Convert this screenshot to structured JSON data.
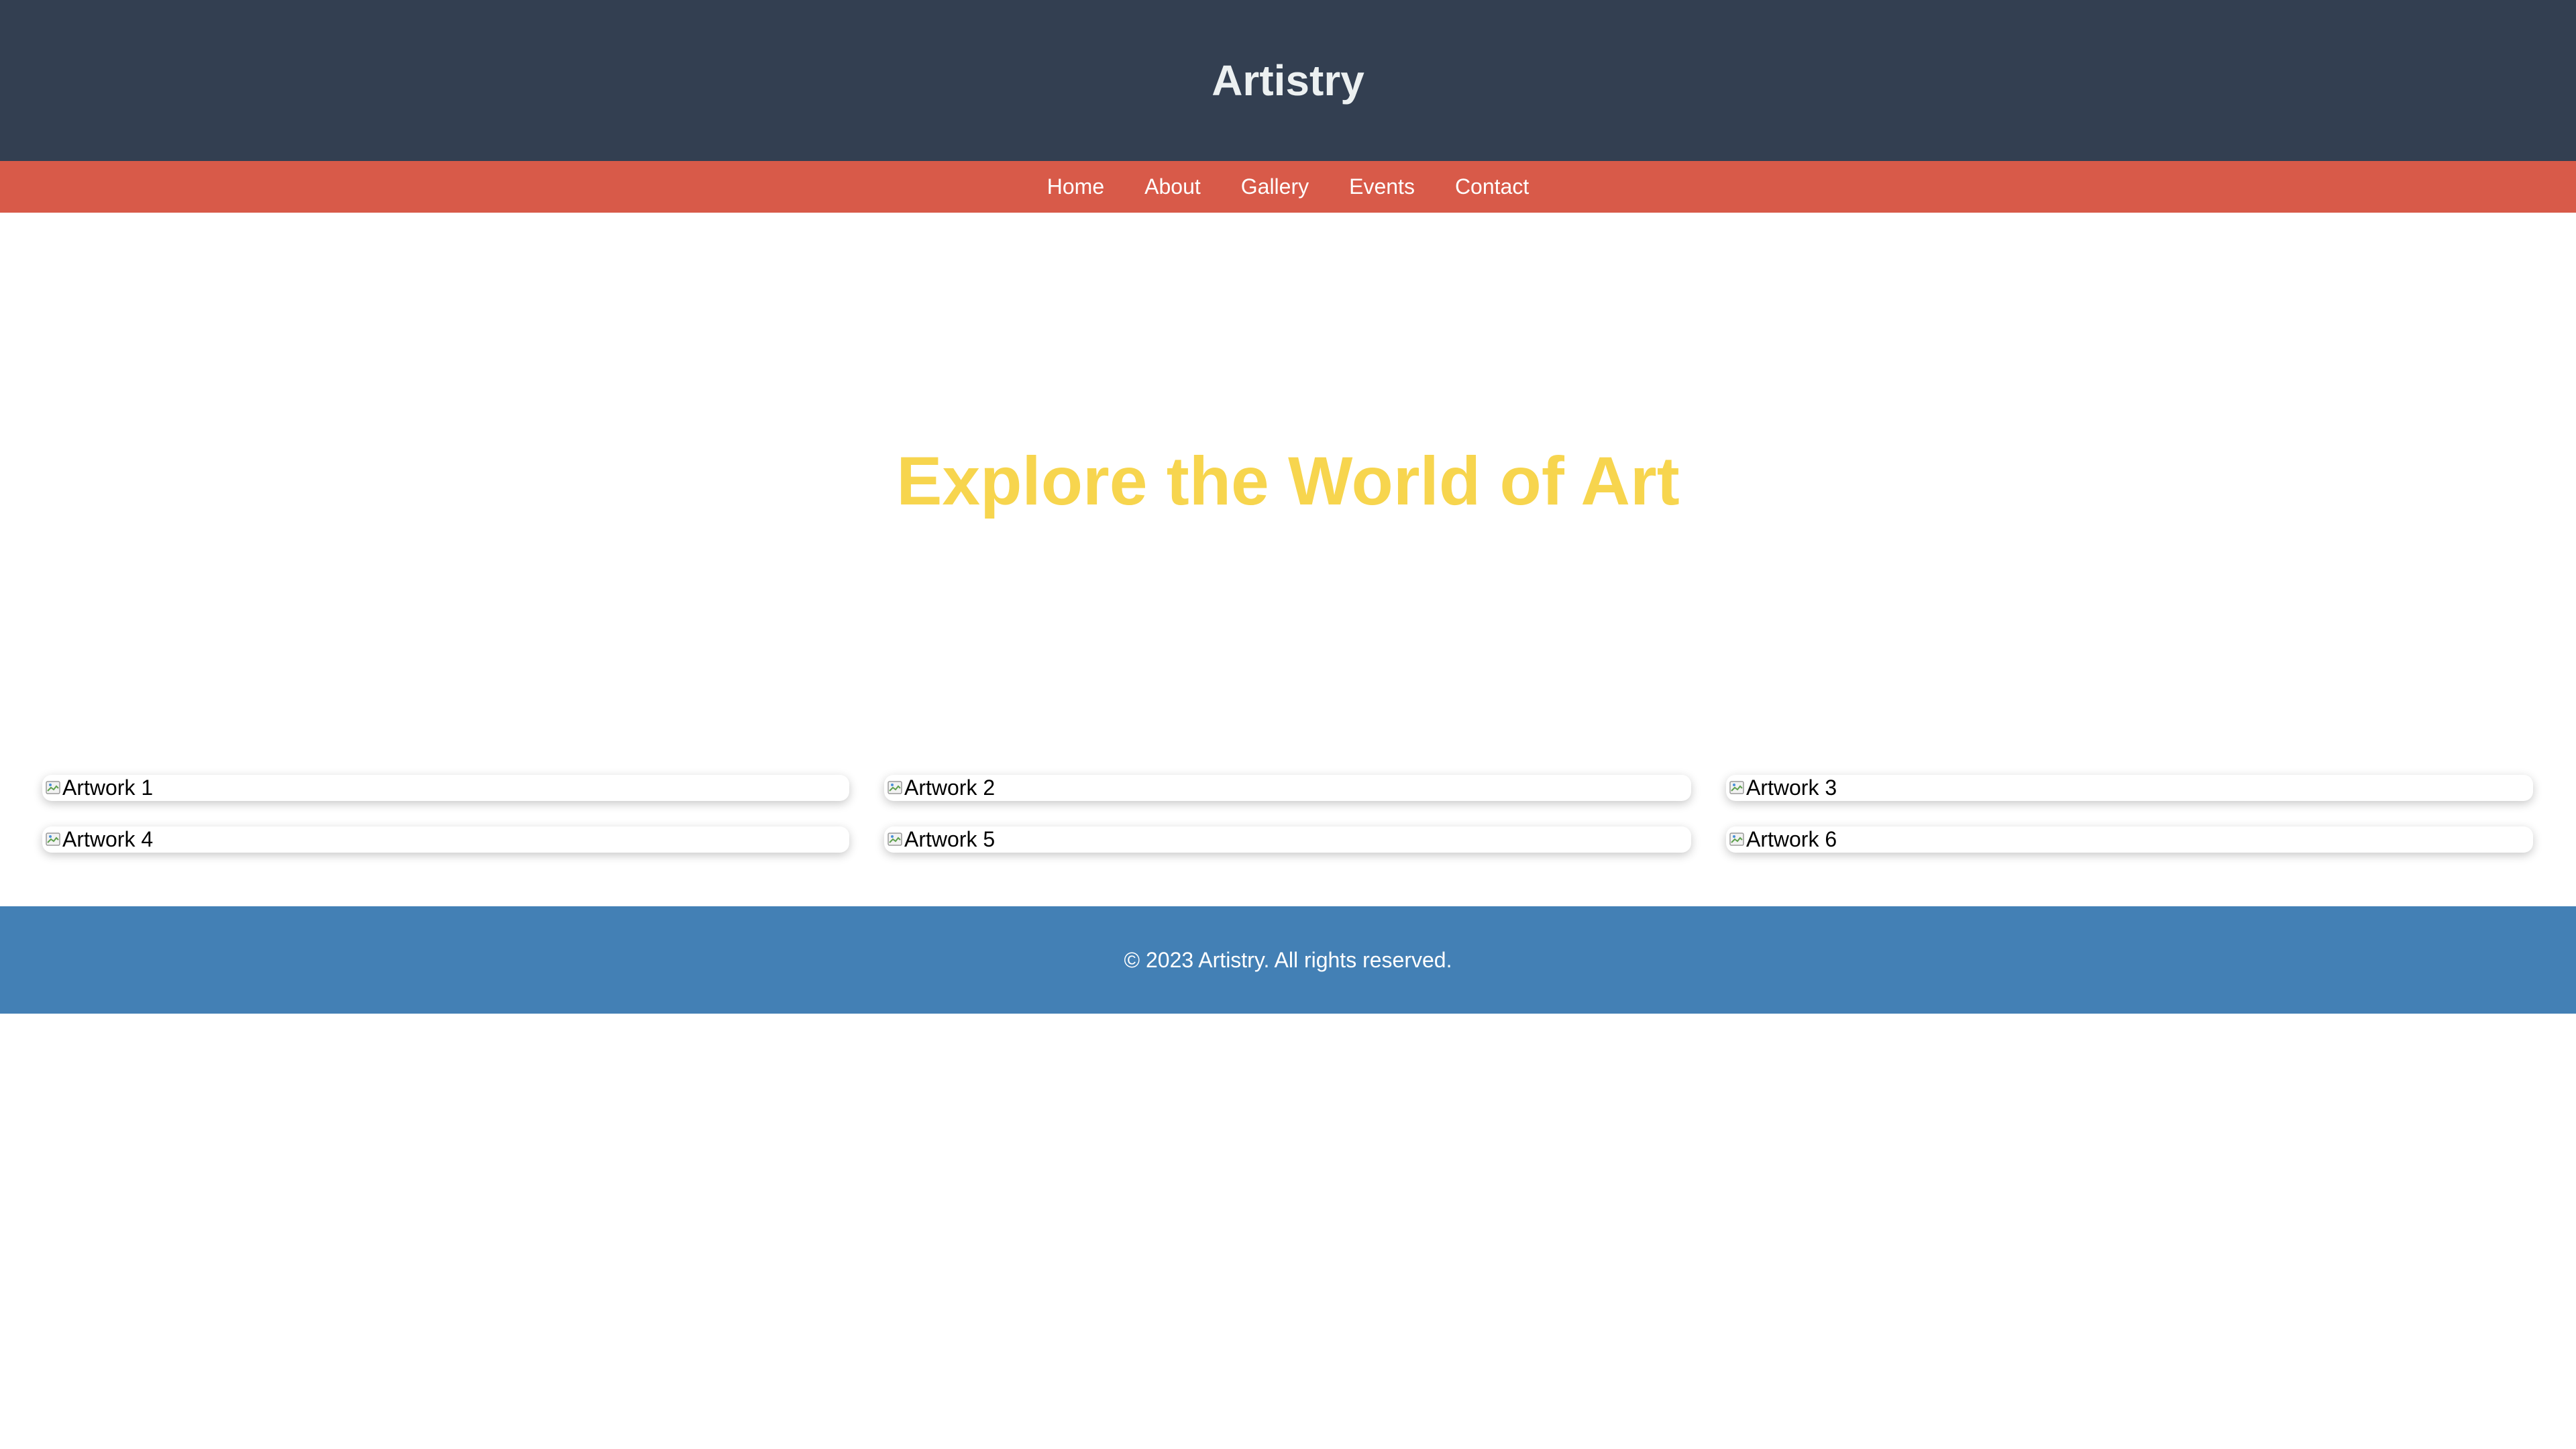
{
  "header": {
    "title": "Artistry"
  },
  "nav": {
    "items": [
      {
        "label": "Home"
      },
      {
        "label": "About"
      },
      {
        "label": "Gallery"
      },
      {
        "label": "Events"
      },
      {
        "label": "Contact"
      }
    ]
  },
  "hero": {
    "title": "Explore the World of Art"
  },
  "gallery": {
    "items": [
      {
        "alt": "Artwork 1",
        "icon": "broken-image-icon"
      },
      {
        "alt": "Artwork 2",
        "icon": "broken-image-icon"
      },
      {
        "alt": "Artwork 3",
        "icon": "broken-image-icon"
      },
      {
        "alt": "Artwork 4",
        "icon": "broken-image-icon"
      },
      {
        "alt": "Artwork 5",
        "icon": "broken-image-icon"
      },
      {
        "alt": "Artwork 6",
        "icon": "broken-image-icon"
      }
    ]
  },
  "footer": {
    "text": "© 2023 Artistry. All rights reserved."
  },
  "colors": {
    "header_bg": "#333f51",
    "nav_bg": "#d85a49",
    "hero_text": "#f7d54e",
    "footer_bg": "#4380b5"
  }
}
